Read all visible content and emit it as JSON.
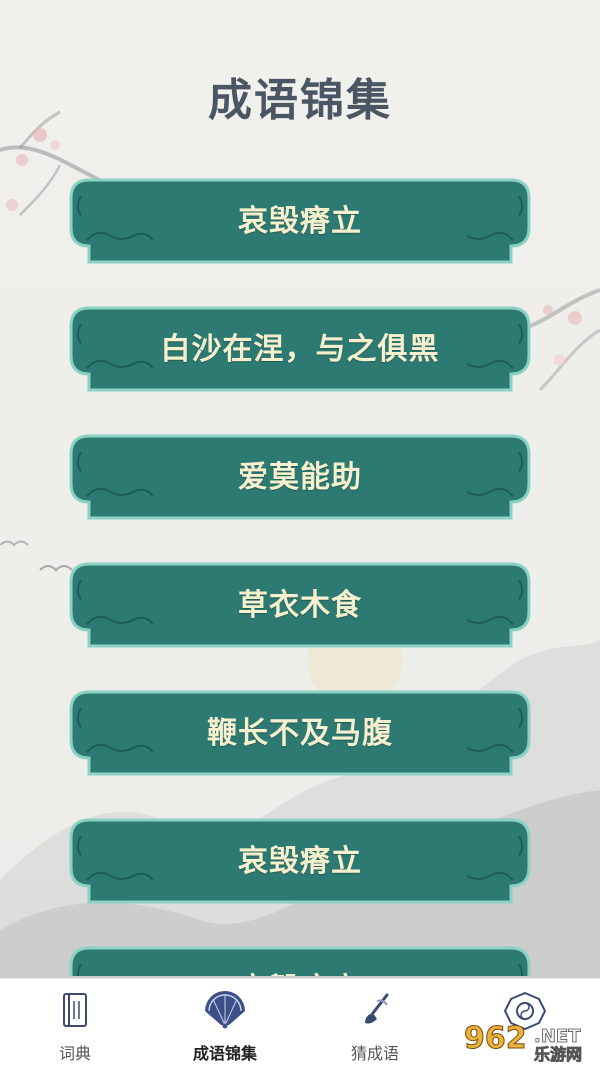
{
  "page": {
    "title": "成语锦集"
  },
  "idioms": [
    {
      "text": "哀毁瘠立"
    },
    {
      "text": "白沙在涅，与之俱黑"
    },
    {
      "text": "爱莫能助"
    },
    {
      "text": "草衣木食"
    },
    {
      "text": "鞭长不及马腹"
    },
    {
      "text": "哀毁瘠立"
    },
    {
      "text": "哀毁瘠立"
    }
  ],
  "tabbar": {
    "tabs": [
      {
        "label": "词典",
        "icon": "book-icon",
        "active": false
      },
      {
        "label": "成语锦集",
        "icon": "fan-icon",
        "active": true
      },
      {
        "label": "猜成语",
        "icon": "brush-icon",
        "active": false
      },
      {
        "label": "",
        "icon": "bagua-icon",
        "active": false
      }
    ]
  },
  "watermark": {
    "brand_number": "962",
    "brand_suffix": ".NET",
    "brand_tagline": "乐游网"
  },
  "colors": {
    "card_fill": "#2c7a72",
    "card_border": "#8bd1c4",
    "card_text": "#f6f0cf",
    "title": "#4b5665",
    "tab_active_icon": "#3d4f86"
  }
}
